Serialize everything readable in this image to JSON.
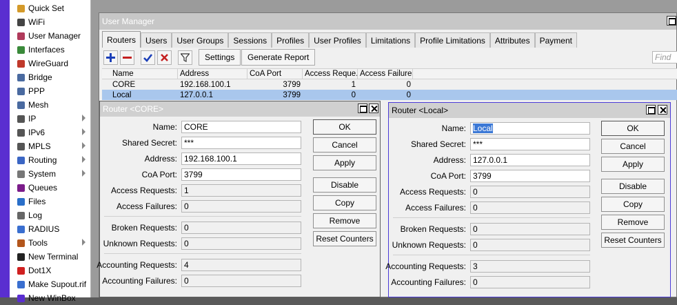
{
  "sidebar": {
    "items": [
      {
        "label": "Quick Set",
        "icon": "quick-set-icon",
        "arrow": false
      },
      {
        "label": "WiFi",
        "icon": "wifi-icon",
        "arrow": false
      },
      {
        "label": "User Manager",
        "icon": "user-manager-icon",
        "arrow": false
      },
      {
        "label": "Interfaces",
        "icon": "interfaces-icon",
        "arrow": false
      },
      {
        "label": "WireGuard",
        "icon": "wireguard-icon",
        "arrow": false
      },
      {
        "label": "Bridge",
        "icon": "bridge-icon",
        "arrow": false
      },
      {
        "label": "PPP",
        "icon": "ppp-icon",
        "arrow": false
      },
      {
        "label": "Mesh",
        "icon": "mesh-icon",
        "arrow": false
      },
      {
        "label": "IP",
        "icon": "ip-icon",
        "arrow": true
      },
      {
        "label": "IPv6",
        "icon": "ipv6-icon",
        "arrow": true
      },
      {
        "label": "MPLS",
        "icon": "mpls-icon",
        "arrow": true
      },
      {
        "label": "Routing",
        "icon": "routing-icon",
        "arrow": true
      },
      {
        "label": "System",
        "icon": "system-icon",
        "arrow": true
      },
      {
        "label": "Queues",
        "icon": "queues-icon",
        "arrow": false
      },
      {
        "label": "Files",
        "icon": "files-icon",
        "arrow": false
      },
      {
        "label": "Log",
        "icon": "log-icon",
        "arrow": false
      },
      {
        "label": "RADIUS",
        "icon": "radius-icon",
        "arrow": false
      },
      {
        "label": "Tools",
        "icon": "tools-icon",
        "arrow": true
      },
      {
        "label": "New Terminal",
        "icon": "terminal-icon",
        "arrow": false
      },
      {
        "label": "Dot1X",
        "icon": "dot1x-icon",
        "arrow": false
      },
      {
        "label": "Make Supout.rif",
        "icon": "supout-icon",
        "arrow": false
      },
      {
        "label": "New WinBox",
        "icon": "winbox-icon",
        "arrow": false
      }
    ]
  },
  "user_manager": {
    "title": "User Manager",
    "tabs": [
      "Routers",
      "Users",
      "User Groups",
      "Sessions",
      "Profiles",
      "User Profiles",
      "Limitations",
      "Profile Limitations",
      "Attributes",
      "Payment"
    ],
    "active_tab": "Routers",
    "toolbar": {
      "settings": "Settings",
      "generate_report": "Generate Report",
      "find_placeholder": "Find"
    },
    "columns": [
      "Name",
      "Address",
      "CoA Port",
      "Access Reque...",
      "Access Failures"
    ],
    "rows": [
      {
        "name": "CORE",
        "address": "192.168.100.1",
        "coa_port": "3799",
        "access_requests": "1",
        "access_failures": "0"
      },
      {
        "name": "Local",
        "address": "127.0.0.1",
        "coa_port": "3799",
        "access_requests": "0",
        "access_failures": "0"
      }
    ]
  },
  "router_core": {
    "title": "Router <CORE>",
    "labels": {
      "name": "Name:",
      "shared_secret": "Shared Secret:",
      "address": "Address:",
      "coa_port": "CoA Port:",
      "access_requests": "Access Requests:",
      "access_failures": "Access Failures:",
      "broken_requests": "Broken Requests:",
      "unknown_requests": "Unknown Requests:",
      "accounting_requests": "Accounting Requests:",
      "accounting_failures": "Accounting Failures:"
    },
    "values": {
      "name": "CORE",
      "shared_secret": "***",
      "address": "192.168.100.1",
      "coa_port": "3799",
      "access_requests": "1",
      "access_failures": "0",
      "broken_requests": "0",
      "unknown_requests": "0",
      "accounting_requests": "4",
      "accounting_failures": "0"
    },
    "buttons": [
      "OK",
      "Cancel",
      "Apply",
      "Disable",
      "Copy",
      "Remove",
      "Reset Counters"
    ]
  },
  "router_local": {
    "title": "Router <Local>",
    "labels": {
      "name": "Name:",
      "shared_secret": "Shared Secret:",
      "address": "Address:",
      "coa_port": "CoA Port:",
      "access_requests": "Access Requests:",
      "access_failures": "Access Failures:",
      "broken_requests": "Broken Requests:",
      "unknown_requests": "Unknown Requests:",
      "accounting_requests": "Accounting Requests:",
      "accounting_failures": "Accounting Failures:"
    },
    "values": {
      "name": "Local",
      "shared_secret": "***",
      "address": "127.0.0.1",
      "coa_port": "3799",
      "access_requests": "0",
      "access_failures": "0",
      "broken_requests": "0",
      "unknown_requests": "0",
      "accounting_requests": "3",
      "accounting_failures": "0"
    },
    "buttons": [
      "OK",
      "Cancel",
      "Apply",
      "Disable",
      "Copy",
      "Remove",
      "Reset Counters"
    ]
  },
  "colors": {
    "rail": "#5a2ed0",
    "selection": "#a9c7ed",
    "active_title": "#4a3ad8",
    "text_highlight": "#3b78d6"
  }
}
